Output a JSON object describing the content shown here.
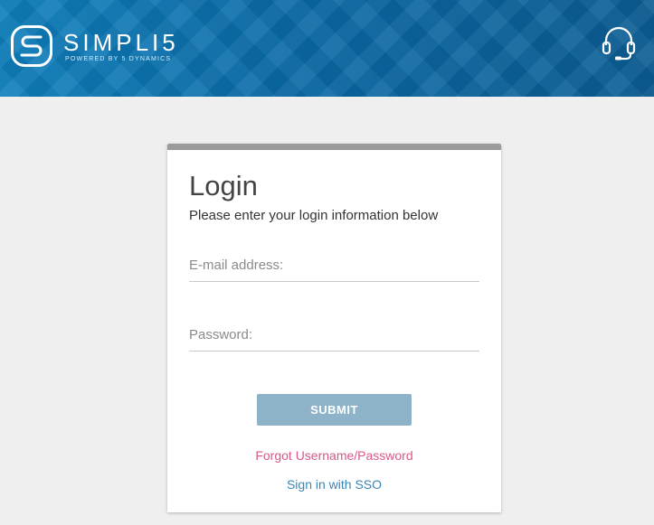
{
  "header": {
    "brand_name": "SIMPLI5",
    "brand_tagline": "POWERED BY 5 DYNAMICS",
    "support_icon": "headset-icon",
    "logo_icon": "s-logo-mark"
  },
  "login": {
    "title": "Login",
    "subtitle": "Please enter your login information below",
    "email_placeholder": "E-mail address:",
    "email_value": "",
    "password_placeholder": "Password:",
    "password_value": "",
    "submit_label": "SUBMIT",
    "forgot_link": "Forgot Username/Password",
    "sso_link": "Sign in with SSO"
  },
  "colors": {
    "header_bg": "#0a6aa6",
    "submit_bg": "#8eb3c9",
    "forgot_link": "#d9578a",
    "sso_link": "#3a86b4",
    "card_topbar": "#9b9b9b"
  }
}
